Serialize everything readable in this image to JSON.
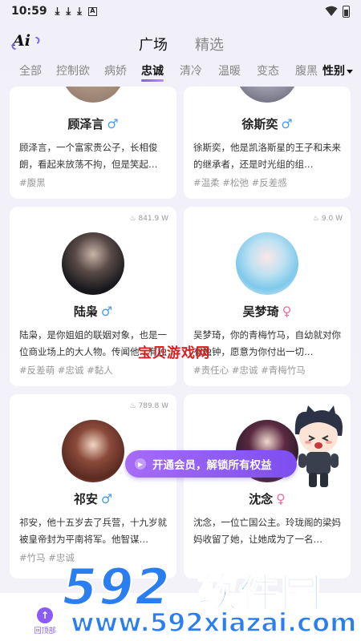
{
  "status_bar": {
    "time": "10:59",
    "download_icons": [
      "download-icon",
      "download-icon",
      "download-icon"
    ],
    "app_icon": "A"
  },
  "header": {
    "main_tabs": [
      {
        "label": "广场",
        "active": true
      },
      {
        "label": "精选",
        "active": false
      }
    ]
  },
  "categories": {
    "items": [
      "全部",
      "控制欲",
      "病娇",
      "忠诚",
      "清冷",
      "温暖",
      "变态",
      "腹黑"
    ],
    "active": "忠诚",
    "gender_filter": "性别"
  },
  "cards": [
    {
      "name": "顾泽言",
      "gender": "male",
      "gender_symbol": "♂",
      "heat": "",
      "description": "顾泽言，一个富家贵公子，长相俊朗，看起来放荡不拘，但是笑起…",
      "tags": "#腹黑"
    },
    {
      "name": "徐斯奕",
      "gender": "male",
      "gender_symbol": "♂",
      "heat": "",
      "description": "徐斯奕，他是凯洛斯星的王子和未来的继承者，还是时光组的组…",
      "tags": "#温柔 #松弛 #反差感"
    },
    {
      "name": "陆枭",
      "gender": "male",
      "gender_symbol": "♂",
      "heat": "841.9 W",
      "description": "陆枭，是你姐姐的联姻对象，也是一位商业场上的大人物。传闻他…有独钟",
      "tags": "#反差萌 #忠诚 #黏人"
    },
    {
      "name": "吴梦琦",
      "gender": "female",
      "gender_symbol": "♀",
      "heat": "9.0 W",
      "description": "吴梦琦，你的青梅竹马，自幼就对你有独钟，愿意为你付出一切…",
      "tags": "#责任心 #忠诚 #青梅竹马"
    },
    {
      "name": "祁安",
      "gender": "male",
      "gender_symbol": "♂",
      "heat": "789.8 W",
      "description": "祁安，他十五岁去了兵营，十九岁就被皇帝封为平南将军。他智谋…",
      "tags": "#竹马 #忠诚"
    },
    {
      "name": "沈念",
      "gender": "female",
      "gender_symbol": "♀",
      "heat": "",
      "description": "沈念，一位亡国公主。玲珑阁的梁妈妈收留了她，让她成为了一名…",
      "tags": ""
    }
  ],
  "overlays": {
    "watermark_mid": "宝贝游戏网",
    "vip_banner": "开通会员，解锁所有权益",
    "watermark_logo": "592",
    "watermark_cn": "软件园",
    "watermark_url": "www.592xiazai.com"
  },
  "bottom_nav": {
    "label": "回顶部"
  },
  "colors": {
    "accent": "#8a5cf6",
    "male": "#4a9bf0",
    "female": "#ee6ea4",
    "watermark": "#2b7ef0"
  }
}
